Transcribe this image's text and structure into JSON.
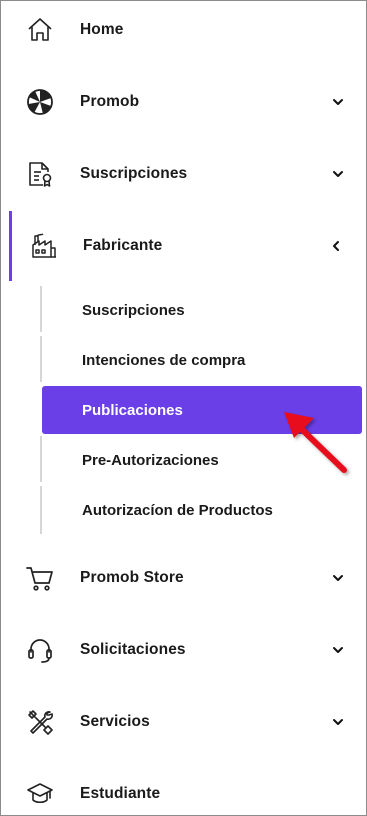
{
  "nav": {
    "items": [
      {
        "label": "Home",
        "icon": "home-icon"
      },
      {
        "label": "Promob",
        "icon": "promob-logo-icon",
        "chevron": "chevron-down-icon"
      },
      {
        "label": "Suscripciones",
        "icon": "certificate-icon",
        "chevron": "chevron-down-icon"
      },
      {
        "label": "Fabricante",
        "icon": "factory-icon",
        "chevron": "chevron-left-icon"
      },
      {
        "label": "Promob Store",
        "icon": "cart-icon",
        "chevron": "chevron-down-icon"
      },
      {
        "label": "Solicitaciones",
        "icon": "headset-icon",
        "chevron": "chevron-down-icon"
      },
      {
        "label": "Servicios",
        "icon": "tools-icon",
        "chevron": "chevron-down-icon"
      },
      {
        "label": "Estudiante",
        "icon": "graduation-cap-icon"
      }
    ],
    "fabricante_submenu": [
      {
        "label": "Suscripciones"
      },
      {
        "label": "Intenciones de compra"
      },
      {
        "label": "Publicaciones",
        "selected": true
      },
      {
        "label": "Pre-Autorizaciones"
      },
      {
        "label": "Autorizacíon de Productos"
      }
    ]
  },
  "colors": {
    "accent": "#6a3fe8",
    "active_bar": "#6c3fea",
    "annotation_arrow": "#e8111b"
  }
}
